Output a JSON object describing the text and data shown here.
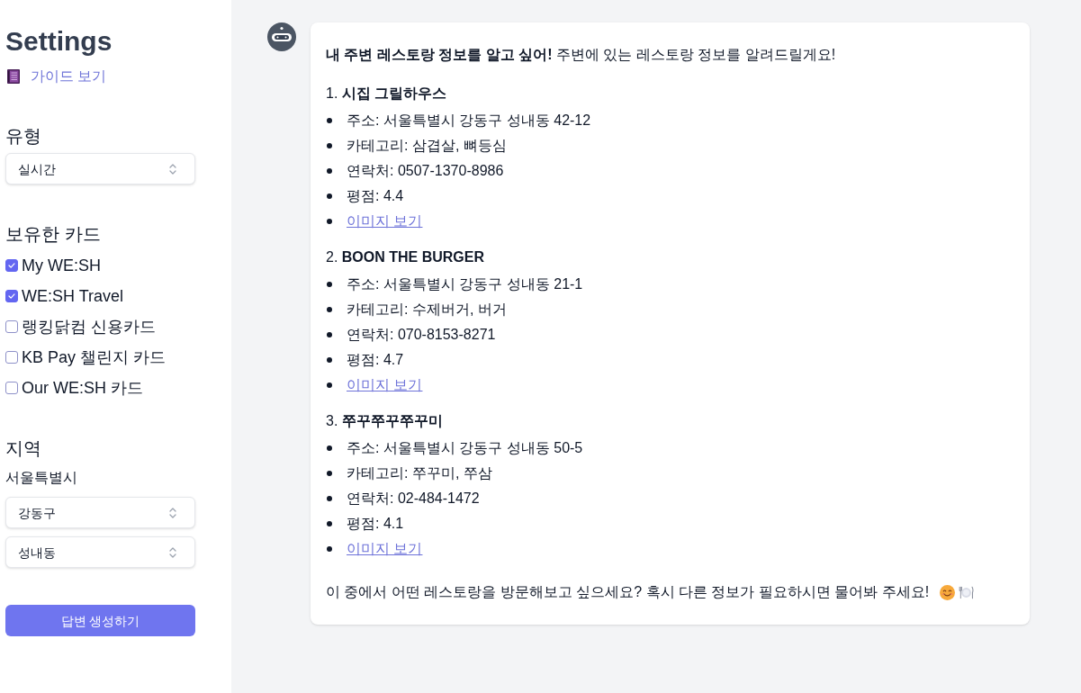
{
  "sidebar": {
    "title": "Settings",
    "guide_link": "가이드 보기",
    "type_label": "유형",
    "type_select": {
      "value": "실시간"
    },
    "cards_label": "보유한 카드",
    "cards": [
      {
        "label": "My WE:SH",
        "checked": true
      },
      {
        "label": "WE:SH Travel",
        "checked": true
      },
      {
        "label": "랭킹닭컴 신용카드",
        "checked": false
      },
      {
        "label": "KB Pay 챌린지 카드",
        "checked": false
      },
      {
        "label": "Our WE:SH 카드",
        "checked": false
      }
    ],
    "region_label": "지역",
    "city": "서울특별시",
    "region_selects": [
      {
        "value": "강동구"
      },
      {
        "value": "성내동"
      }
    ],
    "generate_button": "답변 생성하기"
  },
  "chat": {
    "message": {
      "intro": "**내 주변 레스토랑 정보를 알고 싶어!** 주변에 있는 레스토랑 정보를 알려드릴게요!",
      "restaurants": [
        {
          "heading": "1. **시집 그릴하우스**",
          "details": [
            "주소: 서울특별시 강동구 성내동 42-12",
            "카테고리: 삼겹살, 뼈등심",
            "연락처: 0507-1370-8986",
            "평점: 4.4"
          ],
          "image_link": "이미지 보기"
        },
        {
          "heading": "2. **BOON THE BURGER**",
          "details": [
            "주소: 서울특별시 강동구 성내동 21-1",
            "카테고리: 수제버거, 버거",
            "연락처: 070-8153-8271",
            "평점: 4.7"
          ],
          "image_link": "이미지 보기"
        },
        {
          "heading": "3. **쭈꾸쭈꾸쭈꾸미**",
          "details": [
            "주소: 서울특별시 강동구 성내동 50-5",
            "카테고리: 쭈꾸미, 쭈삼",
            "연락처: 02-484-1472",
            "평점: 4.1"
          ],
          "image_link": "이미지 보기"
        }
      ],
      "closing": "이 중에서 어떤 레스토랑을 방문해보고 싶으세요? 혹시 다른 정보가 필요하시면 물어봐 주세요!"
    }
  }
}
